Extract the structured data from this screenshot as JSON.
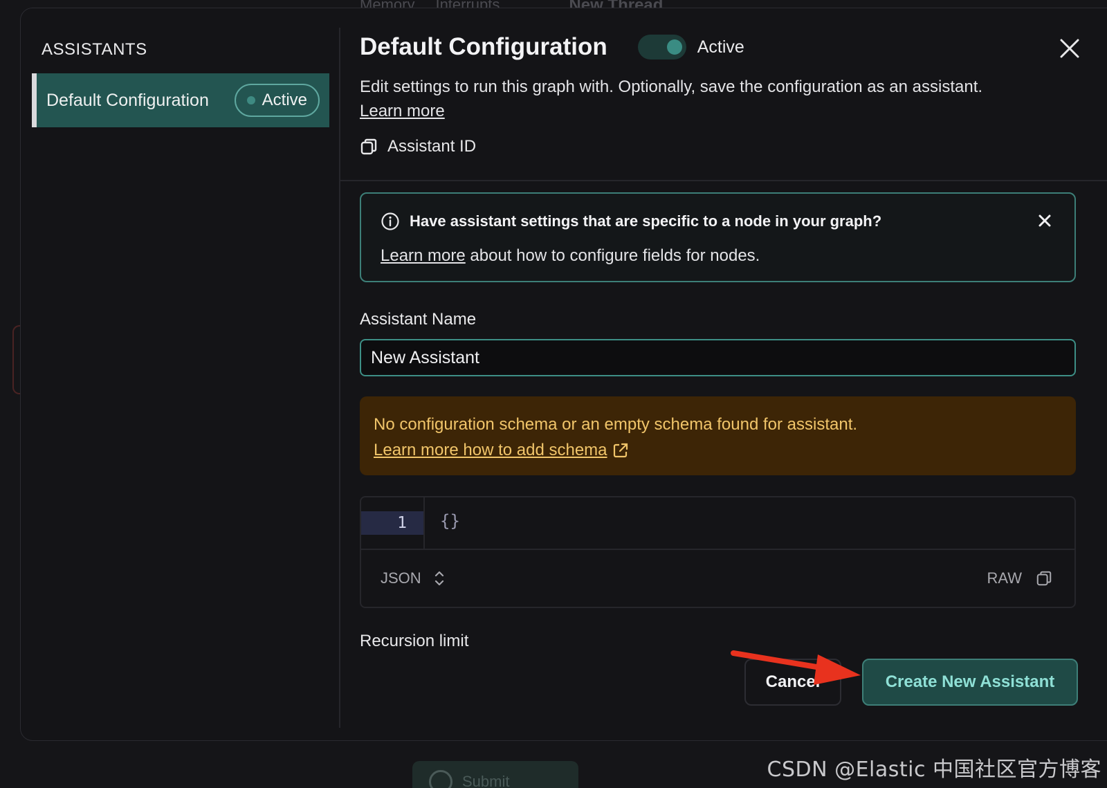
{
  "background": {
    "tabs": [
      "Memory",
      "Interrupts"
    ],
    "thread": "New Thread",
    "submit": "Submit"
  },
  "watermark": "CSDN @Elastic 中国社区官方博客",
  "sidebar": {
    "title": "ASSISTANTS",
    "items": [
      {
        "label": "Default Configuration",
        "badge": "Active"
      }
    ]
  },
  "header": {
    "title": "Default Configuration",
    "toggle_label": "Active",
    "toggle_on": true,
    "description": "Edit settings to run this graph with. Optionally, save the configuration as an assistant.",
    "learn_more": "Learn more",
    "assistant_id_label": "Assistant ID"
  },
  "info_banner": {
    "title": "Have assistant settings that are specific to a node in your graph?",
    "link": "Learn more",
    "text": " about how to configure fields for nodes."
  },
  "assistant_name": {
    "label": "Assistant Name",
    "value": "New Assistant"
  },
  "warning": {
    "text": "No configuration schema or an empty schema found for assistant.",
    "link": "Learn more how to add schema"
  },
  "editor": {
    "line_number": "1",
    "code": "{}",
    "format": "JSON",
    "raw_label": "RAW"
  },
  "recursion_label": "Recursion limit",
  "actions": {
    "cancel": "Cancel",
    "create": "Create New Assistant"
  },
  "colors": {
    "accent": "#3d8f86",
    "warning_bg": "#3d2506",
    "warning_text": "#f1c56a",
    "annotation_arrow": "#e8321e"
  }
}
